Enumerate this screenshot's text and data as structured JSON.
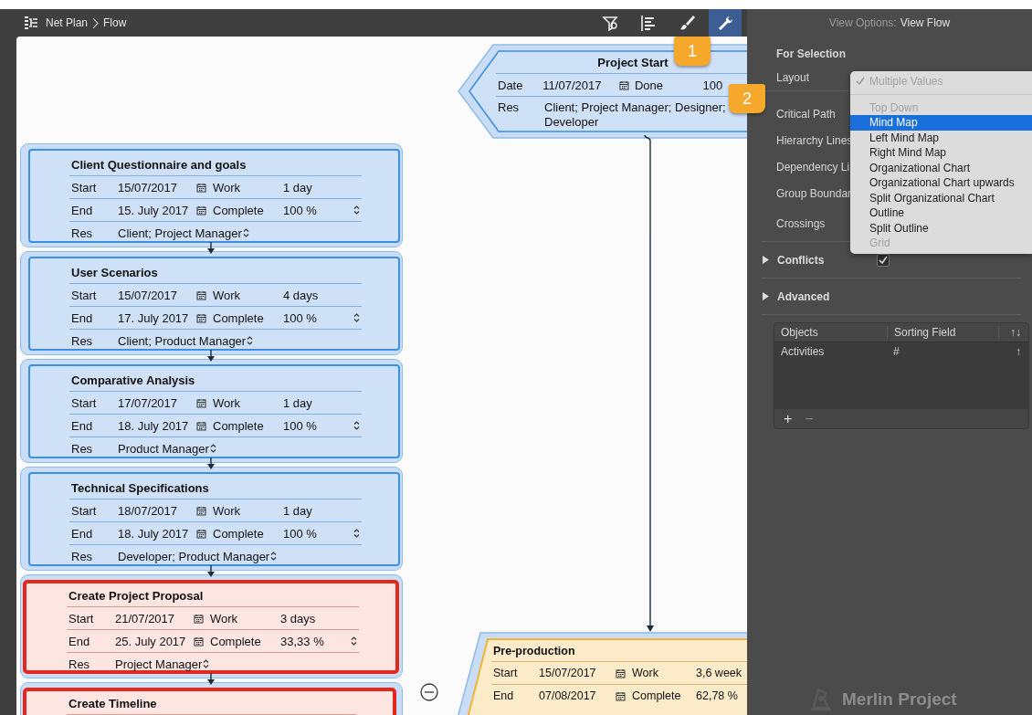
{
  "breadcrumb": [
    {
      "label": "Net Plan"
    },
    {
      "label": "Flow"
    }
  ],
  "toolbar": [
    {
      "kind": "filter",
      "selected": false
    },
    {
      "kind": "align",
      "selected": false
    },
    {
      "kind": "brush",
      "selected": false
    },
    {
      "kind": "wrench",
      "selected": true
    }
  ],
  "canvas": {
    "start_node": {
      "title": "Project Start",
      "rows": [
        {
          "label": "Date",
          "value": "11/07/2017",
          "calendar": true,
          "field": "Done",
          "field_value": "100"
        },
        {
          "label": "Res",
          "value": "Client; Project Manager; Designer; Developer"
        }
      ]
    },
    "cards": [
      {
        "title": "Client Questionnaire and goals",
        "critical": false,
        "rows": [
          {
            "label": "Start",
            "value": "15/07/2017",
            "calendar": true,
            "field": "Work",
            "field_value": "1 day",
            "stepper": false
          },
          {
            "label": "End",
            "value": "15. July 2017",
            "calendar": true,
            "field": "Complete",
            "field_value": "100 %",
            "stepper": true
          },
          {
            "label": "Res",
            "value": "Client; Project Manager",
            "stepper": true
          }
        ]
      },
      {
        "title": "User Scenarios",
        "critical": false,
        "rows": [
          {
            "label": "Start",
            "value": "15/07/2017",
            "calendar": true,
            "field": "Work",
            "field_value": "4 days",
            "stepper": false
          },
          {
            "label": "End",
            "value": "17. July 2017",
            "calendar": true,
            "field": "Complete",
            "field_value": "100 %",
            "stepper": true
          },
          {
            "label": "Res",
            "value": "Client; Product Manager",
            "stepper": true
          }
        ]
      },
      {
        "title": "Comparative Analysis",
        "critical": false,
        "rows": [
          {
            "label": "Start",
            "value": "17/07/2017",
            "calendar": true,
            "field": "Work",
            "field_value": "1 day",
            "stepper": false
          },
          {
            "label": "End",
            "value": "18. July 2017",
            "calendar": true,
            "field": "Complete",
            "field_value": "100 %",
            "stepper": true
          },
          {
            "label": "Res",
            "value": "Product Manager",
            "stepper": true
          }
        ]
      },
      {
        "title": "Technical Specifications",
        "critical": false,
        "rows": [
          {
            "label": "Start",
            "value": "18/07/2017",
            "calendar": true,
            "field": "Work",
            "field_value": "1 day",
            "stepper": false
          },
          {
            "label": "End",
            "value": "18. July 2017",
            "calendar": true,
            "field": "Complete",
            "field_value": "100 %",
            "stepper": true
          },
          {
            "label": "Res",
            "value": "Developer; Product Manager",
            "stepper": true
          }
        ]
      },
      {
        "title": "Create Project Proposal",
        "critical": true,
        "rows": [
          {
            "label": "Start",
            "value": "21/07/2017",
            "calendar": true,
            "field": "Work",
            "field_value": "3 days",
            "stepper": false
          },
          {
            "label": "End",
            "value": "25. July 2017",
            "calendar": true,
            "field": "Complete",
            "field_value": "33,33 %",
            "stepper": true
          },
          {
            "label": "Res",
            "value": "Project Manager",
            "stepper": true
          }
        ]
      },
      {
        "title": "Create Timeline",
        "critical": true
      }
    ],
    "summary_node": {
      "title": "Pre-production",
      "rows": [
        {
          "label": "Start",
          "value": "15/07/2017",
          "calendar": true,
          "field": "Work",
          "field_value": "3,6 week"
        },
        {
          "label": "End",
          "value": "07/08/2017",
          "calendar": true,
          "field": "Complete",
          "field_value": "62,78 %"
        }
      ]
    }
  },
  "callouts": [
    "1",
    "2"
  ],
  "panel": {
    "title_prefix": "View Options:",
    "title": "View Flow",
    "section": "For Selection",
    "options": [
      {
        "label": "Layout"
      },
      {
        "label": "Critical Path"
      },
      {
        "label": "Hierarchy Lines"
      },
      {
        "label": "Dependency Li"
      },
      {
        "label": "Group Boundar"
      },
      {
        "label": "Crossings"
      }
    ],
    "groups": [
      {
        "label": "Conflicts",
        "expanded": false,
        "checked": true
      },
      {
        "label": "Advanced",
        "expanded": false
      }
    ],
    "sort_table": {
      "columns": [
        "Objects",
        "Sorting Field",
        "↑↓"
      ],
      "rows": [
        [
          "Activities",
          "#",
          "↑"
        ]
      ]
    },
    "buttons": [
      "+",
      "−"
    ],
    "logo": "Merlin Project"
  },
  "dropdown": {
    "items": [
      {
        "kind": "option",
        "label": "Multiple Values",
        "checked": true,
        "disabled": true,
        "selected": false
      },
      {
        "kind": "separator"
      },
      {
        "kind": "option",
        "label": "Top Down",
        "checked": false,
        "disabled": true,
        "selected": false
      },
      {
        "kind": "option",
        "label": "Mind Map",
        "checked": false,
        "disabled": false,
        "selected": true
      },
      {
        "kind": "option",
        "label": "Left Mind Map",
        "checked": false,
        "disabled": false,
        "selected": false
      },
      {
        "kind": "option",
        "label": "Right Mind Map",
        "checked": false,
        "disabled": false,
        "selected": false
      },
      {
        "kind": "option",
        "label": "Organizational Chart",
        "checked": false,
        "disabled": false,
        "selected": false
      },
      {
        "kind": "option",
        "label": "Organizational Chart upwards",
        "checked": false,
        "disabled": false,
        "selected": false
      },
      {
        "kind": "option",
        "label": "Split Organizational Chart",
        "checked": false,
        "disabled": false,
        "selected": false
      },
      {
        "kind": "option",
        "label": "Outline",
        "checked": false,
        "disabled": false,
        "selected": false
      },
      {
        "kind": "option",
        "label": "Split Outline",
        "checked": false,
        "disabled": false,
        "selected": false
      },
      {
        "kind": "option",
        "label": "Grid",
        "checked": false,
        "disabled": true,
        "selected": false
      }
    ]
  }
}
